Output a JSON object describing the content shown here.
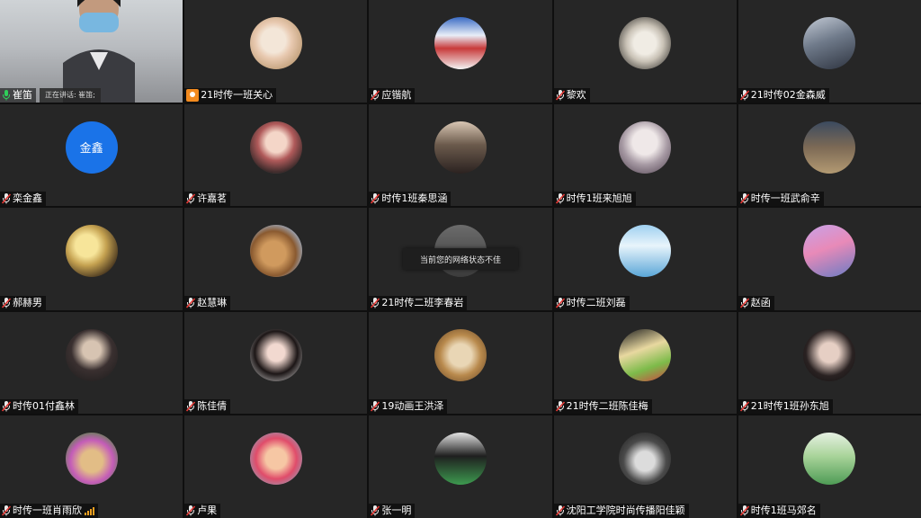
{
  "active_speaker": {
    "label": "正在讲话:",
    "name": "崔笛;"
  },
  "toast": "当前您的网络状态不佳",
  "accent_speaking": "#2f9b52",
  "tiles": [
    {
      "name": "崔笛",
      "avatar": "camera",
      "icon": "mic-on-icon"
    },
    {
      "name": "21时传一班关心",
      "avatar": "puppy-pink",
      "icon": "user-badge-icon"
    },
    {
      "name": "应锴航",
      "avatar": "poster",
      "icon": "mic-muted-icon"
    },
    {
      "name": "黎欢",
      "avatar": "blurry-dog",
      "icon": "mic-muted-icon"
    },
    {
      "name": "21时传02金森威",
      "avatar": "dark-figure",
      "icon": "mic-muted-icon"
    },
    {
      "name": "栾金鑫",
      "avatar": "金鑫",
      "avatar_color": "#1a73e8",
      "icon": "mic-muted-icon"
    },
    {
      "name": "许嘉茗",
      "avatar": "girl-portrait",
      "icon": "mic-muted-icon"
    },
    {
      "name": "时传1班秦思涵",
      "avatar": "girl-hair",
      "icon": "mic-muted-icon"
    },
    {
      "name": "时传1班来旭旭",
      "avatar": "girl-pale",
      "icon": "mic-muted-icon"
    },
    {
      "name": "时传一班武俞辛",
      "avatar": "field",
      "icon": "mic-muted-icon"
    },
    {
      "name": "郝赫男",
      "avatar": "blonde",
      "icon": "mic-muted-icon"
    },
    {
      "name": "赵慧琳",
      "avatar": "dog-sky",
      "icon": "mic-muted-icon"
    },
    {
      "name": "21时传二班李春岩",
      "avatar": "gray-photo",
      "icon": "mic-muted-icon"
    },
    {
      "name": "时传二班刘磊",
      "avatar": "sky-plane",
      "icon": "mic-muted-icon"
    },
    {
      "name": "赵函",
      "avatar": "pink-scene",
      "icon": "mic-muted-icon"
    },
    {
      "name": "时传01付鑫林",
      "avatar": "jay",
      "icon": "mic-muted-icon"
    },
    {
      "name": "陈佳倩",
      "avatar": "girl-black-hair",
      "icon": "mic-muted-icon"
    },
    {
      "name": "19动画王洪泽",
      "avatar": "cat",
      "icon": "mic-muted-icon"
    },
    {
      "name": "21时传二班陈佳梅",
      "avatar": "cartoon",
      "icon": "mic-muted-icon"
    },
    {
      "name": "21时传1班孙东旭",
      "avatar": "woman-dark",
      "icon": "mic-muted-icon"
    },
    {
      "name": "时传一班肖雨欣",
      "avatar": "dog-flower",
      "icon": "mic-muted-icon",
      "signal": true
    },
    {
      "name": "卢果",
      "avatar": "cartoon-girl",
      "icon": "mic-muted-icon"
    },
    {
      "name": "张一明",
      "avatar": "man-green",
      "icon": "mic-muted-icon"
    },
    {
      "name": "沈阳工学院时尚传播阳佳颖",
      "avatar": "bw-hat",
      "icon": "mic-muted-icon"
    },
    {
      "name": "时传1班马郊名",
      "avatar": "green-landscape",
      "icon": "mic-muted-icon"
    }
  ]
}
